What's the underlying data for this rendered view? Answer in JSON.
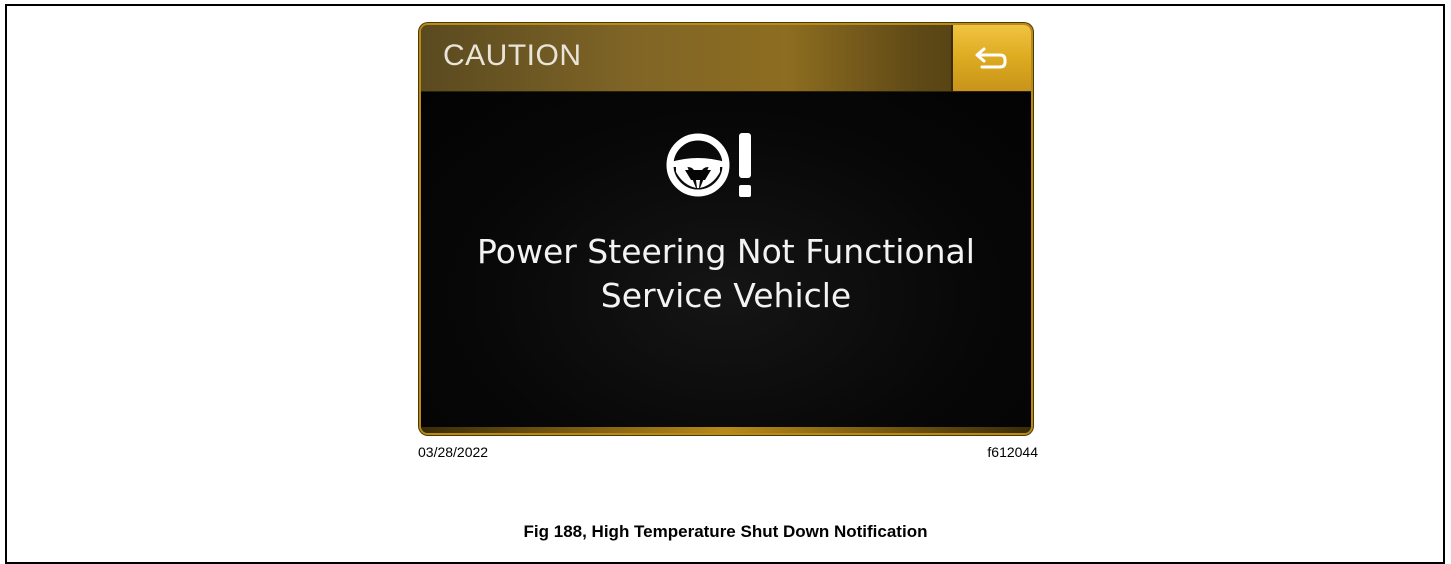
{
  "screen": {
    "header": {
      "title": "CAUTION",
      "back_button_icon": "back-arrow-icon"
    },
    "icon": "steering-wheel-warning-icon",
    "message": {
      "line1": "Power Steering Not Functional",
      "line2": "Service Vehicle"
    },
    "colors": {
      "accent": "#dcab20",
      "background": "#050505",
      "text": "#f3f3f3"
    }
  },
  "figure": {
    "date": "03/28/2022",
    "code": "f612044",
    "caption": "Fig 188, High Temperature Shut Down Notification"
  }
}
